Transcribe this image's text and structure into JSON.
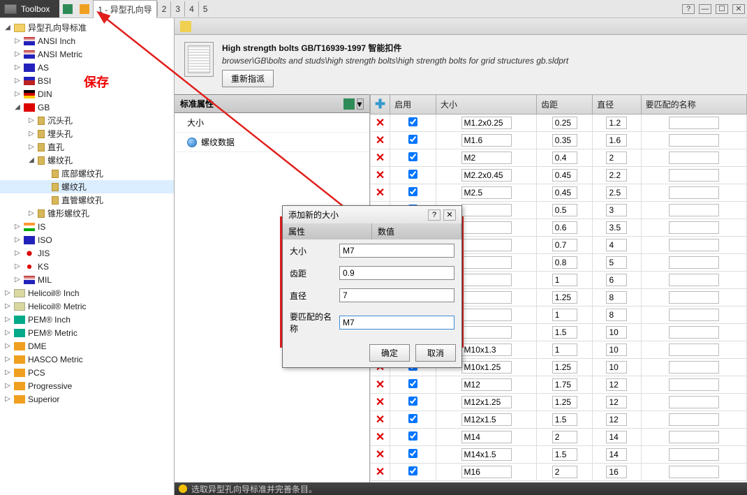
{
  "topbar": {
    "toolbox": "Toolbox",
    "activeTab": "1 - 异型孔向导",
    "tabs2to5": [
      "2",
      "3",
      "4",
      "5"
    ]
  },
  "sidebar": {
    "root": "异型孔向导标准",
    "stds": [
      {
        "id": "ansi-inch",
        "label": "ANSI Inch",
        "flag": "flag-us"
      },
      {
        "id": "ansi-metric",
        "label": "ANSI Metric",
        "flag": "flag-us"
      },
      {
        "id": "as",
        "label": "AS",
        "flag": "flag-au"
      },
      {
        "id": "bsi",
        "label": "BSI",
        "flag": "flag-uk"
      },
      {
        "id": "din",
        "label": "DIN",
        "flag": "flag-de"
      }
    ],
    "gb": "GB",
    "gb_children": [
      {
        "id": "chenkou",
        "label": "沉头孔"
      },
      {
        "id": "maitou",
        "label": "埋头孔"
      },
      {
        "id": "zhi",
        "label": "直孔"
      }
    ],
    "luowen": "螺纹孔",
    "luowen_children": [
      {
        "id": "dibu",
        "label": "底部螺纹孔"
      },
      {
        "id": "luowenkong",
        "label": "螺纹孔",
        "sel": true
      },
      {
        "id": "zhiguan",
        "label": "直管螺纹孔"
      }
    ],
    "zhui": "锥形螺纹孔",
    "stds_after": [
      {
        "id": "is",
        "label": "IS",
        "flag": "flag-in"
      },
      {
        "id": "iso",
        "label": "ISO",
        "flag": "flag-eu"
      },
      {
        "id": "jis",
        "label": "JIS",
        "flag": "flag-jp"
      },
      {
        "id": "ks",
        "label": "KS",
        "flag": "flag-kr"
      },
      {
        "id": "mil",
        "label": "MIL",
        "flag": "flag-mil"
      }
    ],
    "vendors": [
      {
        "id": "helicoil-in",
        "label": "Helicoil® Inch",
        "ic": "coil"
      },
      {
        "id": "helicoil-mm",
        "label": "Helicoil® Metric",
        "ic": "coil"
      },
      {
        "id": "pem-in",
        "label": "PEM® Inch",
        "ic": "pem"
      },
      {
        "id": "pem-mm",
        "label": "PEM® Metric",
        "ic": "pem"
      },
      {
        "id": "dme",
        "label": "DME",
        "ic": "group"
      },
      {
        "id": "hasco",
        "label": "HASCO Metric",
        "ic": "group"
      },
      {
        "id": "pcs",
        "label": "PCS",
        "ic": "group"
      },
      {
        "id": "prog",
        "label": "Progressive",
        "ic": "group"
      },
      {
        "id": "sup",
        "label": "Superior",
        "ic": "group"
      }
    ]
  },
  "save_label": "保存",
  "doc": {
    "title": "High strength bolts GB/T16939-1997 智能扣件",
    "path": "browser\\GB\\bolts and studs\\high strength bolts\\high strength bolts for grid structures gb.sldprt",
    "reassign": "重新指派"
  },
  "props": {
    "header": "标准属性",
    "items": [
      {
        "id": "size",
        "label": "大小"
      },
      {
        "id": "thread",
        "label": "螺纹数据",
        "globe": true
      }
    ]
  },
  "grid": {
    "headers": {
      "enable": "启用",
      "size": "大小",
      "pitch": "齿距",
      "dia": "直径",
      "match": "要匹配的名称"
    },
    "rows": [
      {
        "size": "M1.2x0.25",
        "pitch": "0.25",
        "dia": "1.2",
        "match": ""
      },
      {
        "size": "M1.6",
        "pitch": "0.35",
        "dia": "1.6",
        "match": ""
      },
      {
        "size": "M2",
        "pitch": "0.4",
        "dia": "2",
        "match": ""
      },
      {
        "size": "M2.2x0.45",
        "pitch": "0.45",
        "dia": "2.2",
        "match": ""
      },
      {
        "size": "M2.5",
        "pitch": "0.45",
        "dia": "2.5",
        "match": ""
      },
      {
        "size": "",
        "pitch": "0.5",
        "dia": "3",
        "match": ""
      },
      {
        "size": "",
        "pitch": "0.6",
        "dia": "3.5",
        "match": ""
      },
      {
        "size": "",
        "pitch": "0.7",
        "dia": "4",
        "match": ""
      },
      {
        "size": "",
        "pitch": "0.8",
        "dia": "5",
        "match": ""
      },
      {
        "size": "",
        "pitch": "1",
        "dia": "6",
        "match": ""
      },
      {
        "size": "",
        "pitch": "1.25",
        "dia": "8",
        "match": ""
      },
      {
        "size": "",
        "pitch": "1",
        "dia": "8",
        "match": ""
      },
      {
        "size": "",
        "pitch": "1.5",
        "dia": "10",
        "match": ""
      },
      {
        "size": "M10x1.3",
        "pitch": "1",
        "dia": "10",
        "match": ""
      },
      {
        "size": "M10x1.25",
        "pitch": "1.25",
        "dia": "10",
        "match": ""
      },
      {
        "size": "M12",
        "pitch": "1.75",
        "dia": "12",
        "match": ""
      },
      {
        "size": "M12x1.25",
        "pitch": "1.25",
        "dia": "12",
        "match": ""
      },
      {
        "size": "M12x1.5",
        "pitch": "1.5",
        "dia": "12",
        "match": ""
      },
      {
        "size": "M14",
        "pitch": "2",
        "dia": "14",
        "match": ""
      },
      {
        "size": "M14x1.5",
        "pitch": "1.5",
        "dia": "14",
        "match": ""
      },
      {
        "size": "M16",
        "pitch": "2",
        "dia": "16",
        "match": ""
      }
    ]
  },
  "dialog": {
    "title": "添加新的大小",
    "col1": "属性",
    "col2": "数值",
    "fields": {
      "size": {
        "label": "大小",
        "value": "M7"
      },
      "pitch": {
        "label": "齿距",
        "value": "0.9"
      },
      "dia": {
        "label": "直径",
        "value": "7"
      },
      "match": {
        "label": "要匹配的名称",
        "value": "M7"
      }
    },
    "ok": "确定",
    "cancel": "取消"
  },
  "status": "选取异型孔向导标准并完善条目。"
}
